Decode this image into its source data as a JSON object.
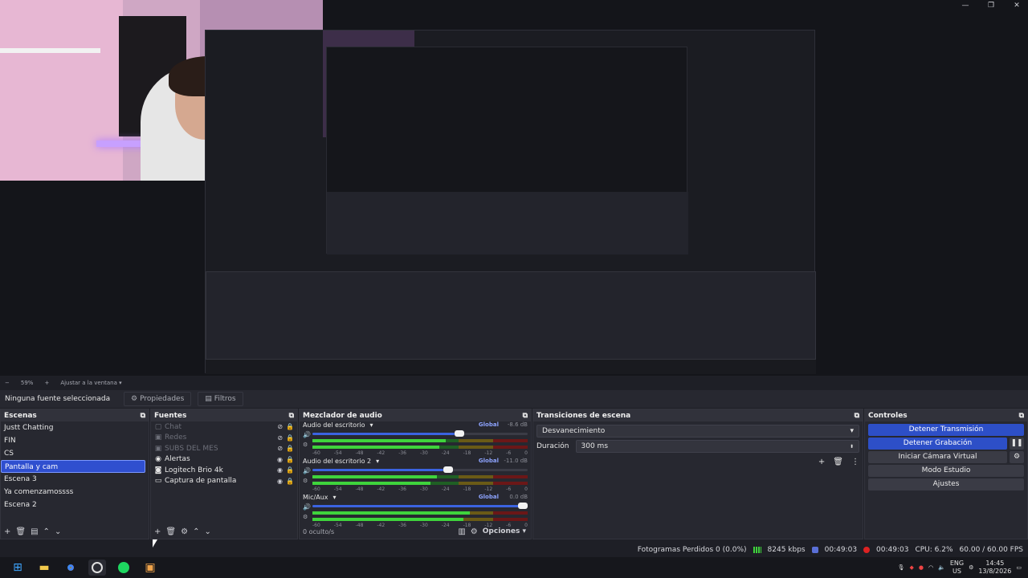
{
  "window": {
    "min": "—",
    "max": "❐",
    "close": "✕"
  },
  "zoom": {
    "percent": "59%",
    "fit": "Ajustar a la ventana"
  },
  "source_bar": {
    "selection": "Ninguna fuente seleccionada",
    "props": "Propiedades",
    "filters": "Filtros"
  },
  "scenes": {
    "title": "Escenas",
    "items": [
      "Justt Chatting",
      "FIN",
      "CS",
      "Pantalla y cam",
      "Escena 3",
      "Ya comenzamossss",
      "Escena 2"
    ],
    "selected_index": 3
  },
  "sources": {
    "title": "Fuentes",
    "items": [
      {
        "label": "Chat",
        "icon": "window-icon",
        "hidden": true
      },
      {
        "label": "Redes",
        "icon": "image-icon",
        "hidden": true
      },
      {
        "label": "SUBS DEL MES",
        "icon": "image-icon",
        "hidden": true
      },
      {
        "label": "Alertas",
        "icon": "browser-icon",
        "hidden": false
      },
      {
        "label": "Logitech Brio 4k",
        "icon": "camera-icon",
        "hidden": false
      },
      {
        "label": "Captura de pantalla",
        "icon": "monitor-icon",
        "hidden": false
      }
    ]
  },
  "mixer": {
    "title": "Mezclador de audio",
    "channels": [
      {
        "name": "Audio del escritorio",
        "tag": "Global",
        "db": "-8.6 dB",
        "volume": 0.66,
        "level": 0.62
      },
      {
        "name": "Audio del escritorio 2",
        "tag": "Global",
        "db": "-11.0 dB",
        "volume": 0.61,
        "level": 0.58
      },
      {
        "name": "Mic/Aux",
        "tag": "Global",
        "db": "0.0 dB",
        "volume": 1.0,
        "level": 0.73
      }
    ],
    "scale": [
      "-60",
      "-54",
      "-48",
      "-42",
      "-36",
      "-30",
      "-24",
      "-18",
      "-12",
      "-6",
      "0"
    ],
    "hidden": "0 oculto/s",
    "options": "Opciones"
  },
  "transitions": {
    "title": "Transiciones de escena",
    "type": "Desvanecimiento",
    "duration_label": "Duración",
    "duration": "300 ms"
  },
  "controls": {
    "title": "Controles",
    "stop_stream": "Detener Transmisión",
    "stop_record": "Detener Grabación",
    "virtual_cam": "Iniciar Cámara Virtual",
    "studio": "Modo Estudio",
    "settings": "Ajustes"
  },
  "status": {
    "dropped": "Fotogramas Perdidos 0 (0.0%)",
    "kbps": "8245 kbps",
    "stream_time": "00:49:03",
    "rec_time": "00:49:03",
    "cpu": "CPU: 6.2%",
    "fps": "60.00 / 60.00 FPS"
  },
  "taskbar": {
    "lang": "ENG",
    "region": "US",
    "time": "14:45",
    "date": "13/8/2026"
  },
  "colors": {
    "accent": "#2d4fc7",
    "bg": "#1e1f26",
    "panel": "#272830"
  }
}
